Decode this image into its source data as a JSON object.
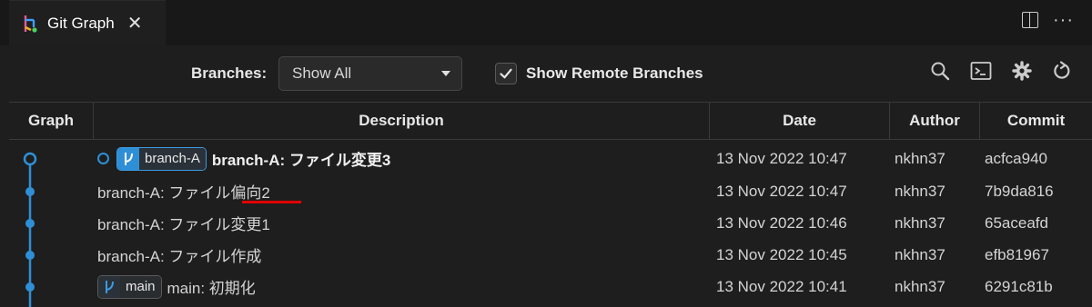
{
  "tab": {
    "title": "Git Graph",
    "close": "✕",
    "icon": "git-graph-icon"
  },
  "tabbar_actions": {
    "more": "···"
  },
  "controls": {
    "branches_label": "Branches:",
    "branch_select_value": "Show All",
    "show_remote_checked": true,
    "show_remote_label": "Show Remote Branches",
    "icons": [
      "search-icon",
      "terminal-icon",
      "gear-icon",
      "refresh-icon"
    ]
  },
  "table": {
    "headers": {
      "graph": "Graph",
      "description": "Description",
      "date": "Date",
      "author": "Author",
      "commit": "Commit"
    },
    "rows": [
      {
        "ref": "branch-A",
        "description": "branch-A: ファイル変更3",
        "date": "13 Nov 2022 10:47",
        "author": "nkhn37",
        "commit": "acfca940"
      },
      {
        "description": "branch-A: ファイル偏向2",
        "date": "13 Nov 2022 10:47",
        "author": "nkhn37",
        "commit": "7b9da816"
      },
      {
        "description": "branch-A: ファイル変更1",
        "date": "13 Nov 2022 10:46",
        "author": "nkhn37",
        "commit": "65aceafd"
      },
      {
        "description": "branch-A: ファイル作成",
        "date": "13 Nov 2022 10:45",
        "author": "nkhn37",
        "commit": "efb81967"
      },
      {
        "ref": "main",
        "description": "main: 初期化",
        "date": "13 Nov 2022 10:41",
        "author": "nkhn37",
        "commit": "6291c81b"
      }
    ]
  },
  "colors": {
    "graph": "#2f8fd6",
    "underline": "#e00000",
    "background": "#1e1e1e"
  }
}
